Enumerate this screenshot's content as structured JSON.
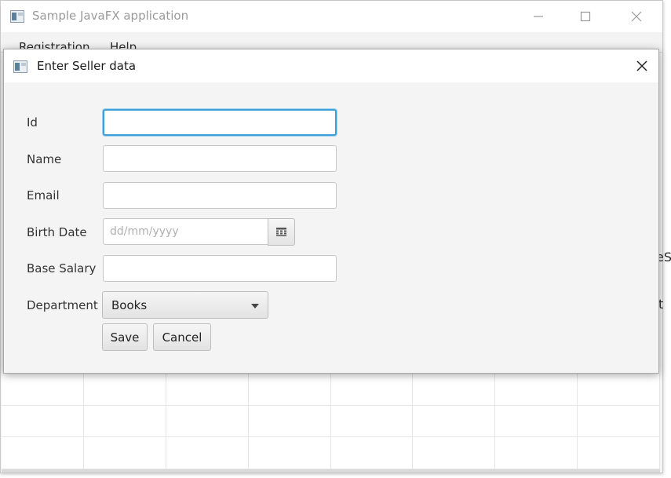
{
  "main_window": {
    "title": "Sample JavaFX application",
    "icons": {
      "app": "app-icon",
      "minimize": "minimize-icon",
      "maximize": "maximize-icon",
      "close": "close-icon"
    },
    "menu": [
      "Registration",
      "Help"
    ],
    "background_fragments": [
      "eS",
      "t"
    ]
  },
  "dialog": {
    "title": "Enter Seller data",
    "icons": {
      "app": "app-icon",
      "close": "close-icon",
      "calendar": "calendar-icon",
      "dropdown": "chevron-down-icon"
    },
    "fields": {
      "id": {
        "label": "Id",
        "value": ""
      },
      "name": {
        "label": "Name",
        "value": ""
      },
      "email": {
        "label": "Email",
        "value": ""
      },
      "birth_date": {
        "label": "Birth Date",
        "value": "",
        "placeholder": "dd/mm/yyyy"
      },
      "base_salary": {
        "label": "Base Salary",
        "value": ""
      },
      "department": {
        "label": "Department",
        "selected": "Books"
      }
    },
    "buttons": {
      "save": "Save",
      "cancel": "Cancel"
    }
  },
  "colors": {
    "focus_ring": "#3c9fd6",
    "dialog_bg": "#f4f4f4",
    "titlebar_bg": "#ffffff"
  }
}
